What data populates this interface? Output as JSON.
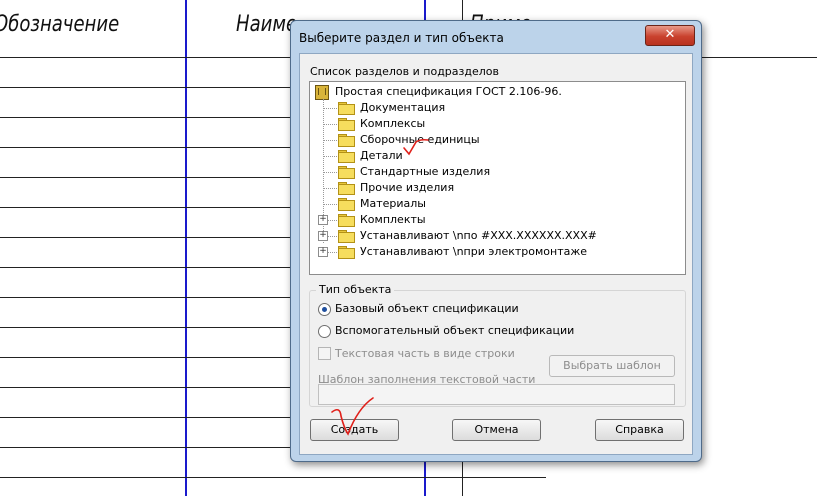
{
  "sheet": {
    "col1_header": "Обозначение",
    "col2_header": "Наиме",
    "col3_header": "Приме-"
  },
  "dialog": {
    "title": "Выберите раздел и тип объекта",
    "close_glyph": "✕",
    "tree_label": "Список разделов и подразделов",
    "tree": {
      "root": "Простая спецификация ГОСТ 2.106-96.",
      "items": [
        {
          "label": "Документация",
          "expandable": false
        },
        {
          "label": "Комплексы",
          "expandable": false
        },
        {
          "label": "Сборочные единицы",
          "expandable": false
        },
        {
          "label": "Детали",
          "expandable": false
        },
        {
          "label": "Стандартные изделия",
          "expandable": false
        },
        {
          "label": "Прочие изделия",
          "expandable": false
        },
        {
          "label": "Материалы",
          "expandable": false
        },
        {
          "label": "Комплекты",
          "expandable": true
        },
        {
          "label": "Устанавливают \\nпо #XXX.XXXXXX.XXX#",
          "expandable": true
        },
        {
          "label": "Устанавливают \\nпри электромонтаже",
          "expandable": true
        }
      ],
      "expand_glyph": "+"
    },
    "object_type": {
      "title": "Тип объекта",
      "option_base": "Базовый объект спецификации",
      "option_aux": "Вспомогательный объект спецификации",
      "selected": "option_base",
      "text_part_checkbox": "Текстовая часть в виде строки",
      "template_button": "Выбрать шаблон",
      "template_label": "Шаблон заполнения текстовой части",
      "template_value": ""
    },
    "buttons": {
      "create": "Создать",
      "cancel": "Отмена",
      "help": "Справка"
    }
  },
  "colors": {
    "frame": "#bcd3ea",
    "blue_line": "#1a1acc",
    "annotation": "#e0201a"
  }
}
